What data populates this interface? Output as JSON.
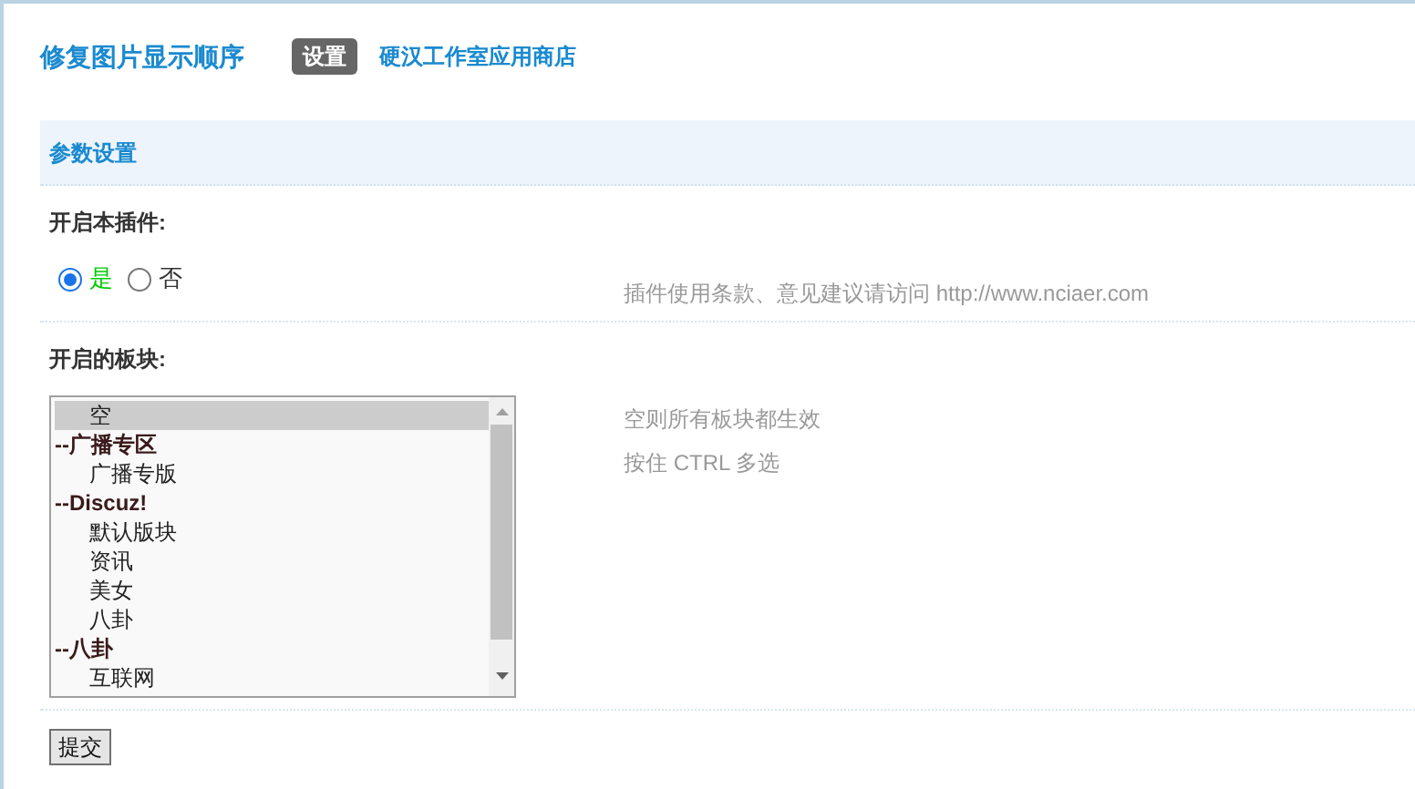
{
  "header": {
    "title": "修复图片显示顺序",
    "tabs": [
      {
        "label": "设置",
        "selected": true
      },
      {
        "label": "硬汉工作室应用商店",
        "selected": false
      }
    ]
  },
  "section": {
    "title": "参数设置"
  },
  "settings": [
    {
      "kind": "radio",
      "label": "开启本插件:",
      "options": [
        {
          "label": "是",
          "selected": true
        },
        {
          "label": "否",
          "selected": false
        }
      ],
      "hint": "插件使用条款、意见建议请访问 http://www.nciaer.com"
    },
    {
      "kind": "listbox",
      "label": "开启的板块:",
      "options": [
        {
          "kind": "option",
          "label": "空",
          "selected": true
        },
        {
          "kind": "group",
          "label": "--广播专区",
          "selected": false
        },
        {
          "kind": "option",
          "label": "广播专版",
          "selected": false
        },
        {
          "kind": "group",
          "label": "--Discuz!",
          "selected": false
        },
        {
          "kind": "option",
          "label": "默认版块",
          "selected": false
        },
        {
          "kind": "option",
          "label": "资讯",
          "selected": false
        },
        {
          "kind": "option",
          "label": "美女",
          "selected": false
        },
        {
          "kind": "option",
          "label": "八卦",
          "selected": false
        },
        {
          "kind": "group",
          "label": "--八卦",
          "selected": false
        },
        {
          "kind": "option",
          "label": "互联网",
          "selected": false
        }
      ],
      "hints": [
        "空则所有板块都生效",
        "按住 CTRL 多选"
      ]
    }
  ],
  "submit": "提交"
}
